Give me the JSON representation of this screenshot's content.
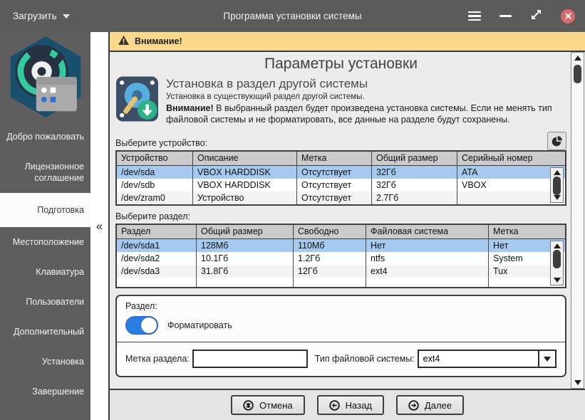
{
  "titlebar": {
    "menu_button": {
      "label": "Загрузить"
    },
    "title": "Программа установки системы"
  },
  "sidebar": {
    "collapse_glyph": "«",
    "items": [
      {
        "label": "Добро пожаловать",
        "active": false
      },
      {
        "label": "Лицензионное соглашение",
        "active": false
      },
      {
        "label": "Подготовка",
        "active": true
      },
      {
        "label": "Местоположение",
        "active": false
      },
      {
        "label": "Клавиатура",
        "active": false
      },
      {
        "label": "Пользователи",
        "active": false
      },
      {
        "label": "Дополнительный",
        "active": false
      },
      {
        "label": "Установка",
        "active": false
      },
      {
        "label": "Завершение",
        "active": false
      }
    ]
  },
  "banner": {
    "text": "Внимание!"
  },
  "page": {
    "title": "Параметры установки",
    "intro": {
      "heading": "Установка в раздел другой системы",
      "subheading": "Установка в существующий раздел другой системы.",
      "note_bold": "Внимание!",
      "note_text": " В выбранный раздел будет произведена установка системы. Если не менять тип файловой системы и не форматировать, все данные на разделе будут сохранены."
    },
    "device_section": {
      "label": "Выберите устройство:",
      "table": {
        "headers": [
          "Устройство",
          "Описание",
          "Метка",
          "Общий размер",
          "Серийный номер"
        ],
        "rows": [
          [
            "/dev/sda",
            "VBOX HARDDISK",
            "Отсутствует",
            "32Гб",
            "ATA"
          ],
          [
            "/dev/sdb",
            "VBOX HARDDISK",
            "Отсутствует",
            "32Гб",
            "VBOX"
          ],
          [
            "/dev/zram0",
            "Устройство",
            "Отсутствует",
            "2.7Гб",
            ""
          ]
        ],
        "selected_row": 0
      }
    },
    "partition_section": {
      "label": "Выберите раздел:",
      "table": {
        "headers": [
          "Раздел",
          "Общий размер",
          "Свободно",
          "Файловая система",
          "Метка"
        ],
        "rows": [
          [
            "/dev/sda1",
            "128Мб",
            "110Мб",
            "Нет",
            "Нет"
          ],
          [
            "/dev/sda2",
            "10.1Гб",
            "1.2Гб",
            "ntfs",
            "System"
          ],
          [
            "/dev/sda3",
            "31.8Гб",
            "12Гб",
            "ext4",
            "Tux"
          ]
        ],
        "selected_row": 0
      }
    },
    "partition_box": {
      "label": "Раздел:",
      "format_label": "Форматировать",
      "format_on": true,
      "label_field": {
        "label": "Метка раздела:",
        "value": ""
      },
      "fs_field": {
        "label": "Тип файловой системы:",
        "value": "ext4"
      }
    }
  },
  "footer": {
    "cancel_label": "Отмена",
    "back_label": "Назад",
    "next_label": "Далее"
  },
  "colors": {
    "titlebar": "#5b5b5b",
    "sidebar": "#5e5e5e",
    "warning_banner": "#fad98c",
    "selection": "#a6c9ef",
    "accent_toggle": "#2b7de2",
    "close_button": "#d96a6a"
  }
}
